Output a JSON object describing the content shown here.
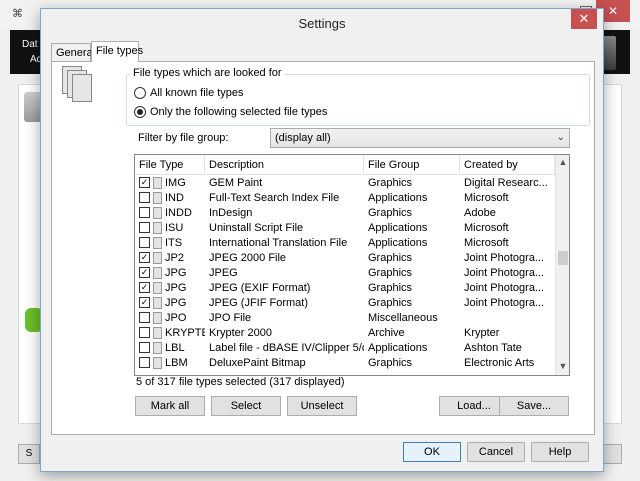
{
  "background": {
    "header_line1": "Dat",
    "header_line2": "Ad",
    "bottom_button": "S"
  },
  "dialog": {
    "title": "Settings",
    "close_glyph": "✕"
  },
  "tabs": [
    {
      "label": "General"
    },
    {
      "label": "File types"
    }
  ],
  "filetypes": {
    "group_label": "File types which are looked for",
    "radio_all": "All known file types",
    "radio_selected": "Only the following selected file types",
    "radio_selected_checked": true,
    "filter_label": "Filter by file group:",
    "filter_value": "(display all)",
    "columns": [
      "File Type",
      "Description",
      "File Group",
      "Created by"
    ],
    "rows": [
      {
        "checked": true,
        "type": "IMG",
        "description": "GEM Paint",
        "group": "Graphics",
        "creator": "Digital Researc..."
      },
      {
        "checked": false,
        "type": "IND",
        "description": "Full-Text Search Index File",
        "group": "Applications",
        "creator": "Microsoft"
      },
      {
        "checked": false,
        "type": "INDD",
        "description": "InDesign",
        "group": "Graphics",
        "creator": "Adobe"
      },
      {
        "checked": false,
        "type": "ISU",
        "description": "Uninstall Script File",
        "group": "Applications",
        "creator": "Microsoft"
      },
      {
        "checked": false,
        "type": "ITS",
        "description": "International Translation File",
        "group": "Applications",
        "creator": "Microsoft"
      },
      {
        "checked": true,
        "type": "JP2",
        "description": "JPEG 2000 File",
        "group": "Graphics",
        "creator": "Joint Photogra..."
      },
      {
        "checked": true,
        "type": "JPG",
        "description": "JPEG",
        "group": "Graphics",
        "creator": "Joint Photogra..."
      },
      {
        "checked": true,
        "type": "JPG",
        "description": "JPEG (EXIF Format)",
        "group": "Graphics",
        "creator": "Joint Photogra..."
      },
      {
        "checked": true,
        "type": "JPG",
        "description": "JPEG (JFIF Format)",
        "group": "Graphics",
        "creator": "Joint Photogra..."
      },
      {
        "checked": false,
        "type": "JPO",
        "description": "JPO File",
        "group": "Miscellaneous",
        "creator": ""
      },
      {
        "checked": false,
        "type": "KRYPTER",
        "description": "Krypter 2000",
        "group": "Archive",
        "creator": "Krypter"
      },
      {
        "checked": false,
        "type": "LBL",
        "description": "Label file - dBASE IV/Clipper 5/dB...",
        "group": "Applications",
        "creator": "Ashton Tate"
      },
      {
        "checked": false,
        "type": "LBM",
        "description": "DeluxePaint Bitmap",
        "group": "Graphics",
        "creator": "Electronic Arts"
      }
    ],
    "status": "5 of 317 file types selected (317 displayed)",
    "buttons": {
      "mark_all": "Mark all",
      "select": "Select",
      "unselect": "Unselect",
      "load": "Load...",
      "save": "Save..."
    }
  },
  "footer": {
    "ok": "OK",
    "cancel": "Cancel",
    "help": "Help"
  },
  "colors": {
    "close_red": "#c75050",
    "default_button_border": "#3c7fb1"
  }
}
